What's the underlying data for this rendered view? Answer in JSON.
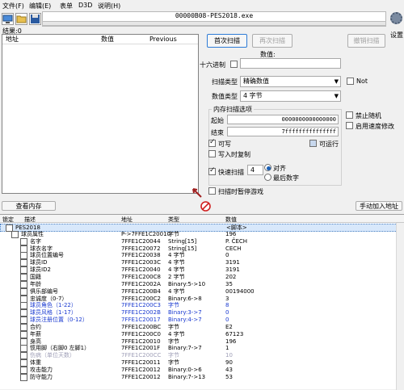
{
  "menu": {
    "file": "文件(F)",
    "edit": "编辑(E)",
    "table": "表单",
    "d3d": "D3D",
    "help": "说明(H)"
  },
  "process_title": "00000B08-PES2018.exe",
  "settings_label": "设置",
  "result_label": "结果:0",
  "found_list": {
    "col_address": "地址",
    "col_value": "数值",
    "col_previous": "Previous"
  },
  "scan": {
    "first_scan": "首次扫描",
    "next_scan": "再次扫描",
    "undo_scan": "撤销扫描",
    "value_label": "数值:",
    "hex_label": "十六进制",
    "scan_type_label": "扫描类型",
    "scan_type_value": "精确数值",
    "not_label": "Not",
    "value_type_label": "数值类型",
    "value_type_value": "4 字节",
    "memory_options_label": "内存扫描选项",
    "start_label": "起始",
    "start_value": "0000000000000000",
    "stop_label": "结束",
    "stop_value": "7fffffffffffffff",
    "writable": "可写",
    "executable": "可运行",
    "copy_on_write": "写入时复制",
    "fast_scan": "快速扫描",
    "fast_scan_value": "4",
    "alignment": "对齐",
    "last_digits": "最后数字",
    "pause_game": "扫描时暂停游戏",
    "disable_random": "禁止随机",
    "speedhack": "启用速度修改"
  },
  "buttons": {
    "memory_view": "查看内存",
    "add_manually": "手动加入地址"
  },
  "table": {
    "headers": {
      "active": "锁定",
      "description": "描述",
      "address": "地址",
      "type": "类型",
      "value": "数值"
    },
    "rows": [
      {
        "desc": "PES2018",
        "addr": "",
        "type": "",
        "value": "<脚本>",
        "cb": true,
        "indent": 0,
        "style": "sel"
      },
      {
        "desc": "球员属性",
        "addr": "P->7FFE1C20010",
        "type": "字节",
        "value": "196",
        "cb": true,
        "indent": 1,
        "style": ""
      },
      {
        "desc": "名字",
        "addr": "7FFE1C20044",
        "type": "String[15]",
        "value": "P. ČECH",
        "cb": true,
        "indent": 2,
        "style": ""
      },
      {
        "desc": "球衣名字",
        "addr": "7FFE1C20072",
        "type": "String[15]",
        "value": "CECH",
        "cb": true,
        "indent": 2,
        "style": ""
      },
      {
        "desc": "球员位置编号",
        "addr": "7FFE1C20038",
        "type": "4 字节",
        "value": "0",
        "cb": true,
        "indent": 2,
        "style": ""
      },
      {
        "desc": "球员ID",
        "addr": "7FFE1C2003C",
        "type": "4 字节",
        "value": "3191",
        "cb": true,
        "indent": 2,
        "style": ""
      },
      {
        "desc": "球员ID2",
        "addr": "7FFE1C20040",
        "type": "4 字节",
        "value": "3191",
        "cb": true,
        "indent": 2,
        "style": ""
      },
      {
        "desc": "国籍",
        "addr": "7FFE1C200C8",
        "type": "2 字节",
        "value": "202",
        "cb": true,
        "indent": 2,
        "style": ""
      },
      {
        "desc": "年龄",
        "addr": "7FFE1C2002A",
        "type": "Binary:5->10",
        "value": "35",
        "cb": true,
        "indent": 2,
        "style": ""
      },
      {
        "desc": "俱乐部编号",
        "addr": "7FFE1C200B4",
        "type": "4 字节",
        "value": "00194000",
        "cb": true,
        "indent": 2,
        "style": ""
      },
      {
        "desc": "忠诚度（0-7）",
        "addr": "7FFE1C200C2",
        "type": "Binary:6->8",
        "value": "3",
        "cb": true,
        "indent": 2,
        "style": ""
      },
      {
        "desc": "球员角色（1-22）",
        "addr": "7FFE1C200C3",
        "type": "字节",
        "value": "8",
        "cb": true,
        "indent": 2,
        "style": "blue"
      },
      {
        "desc": "球员风格（1-17）",
        "addr": "7FFE1C2002B",
        "type": "Binary:3->7",
        "value": "0",
        "cb": true,
        "indent": 2,
        "style": "blue"
      },
      {
        "desc": "球员注册位置（0-12）",
        "addr": "7FFE1C20017",
        "type": "Binary:4->7",
        "value": "0",
        "cb": true,
        "indent": 2,
        "style": "blue"
      },
      {
        "desc": "合约",
        "addr": "7FFE1C200BC",
        "type": "字节",
        "value": "E2",
        "cb": true,
        "indent": 2,
        "style": ""
      },
      {
        "desc": "年薪",
        "addr": "7FFE1C200C0",
        "type": "4 字节",
        "value": "67123",
        "cb": true,
        "indent": 2,
        "style": ""
      },
      {
        "desc": "身高",
        "addr": "7FFE1C20010",
        "type": "字节",
        "value": "196",
        "cb": true,
        "indent": 2,
        "style": ""
      },
      {
        "desc": "惯用脚（右脚0 左脚1）",
        "addr": "7FFE1C2001F",
        "type": "Binary:7->7",
        "value": "1",
        "cb": true,
        "indent": 2,
        "style": ""
      },
      {
        "desc": "伤病（单位天数）",
        "addr": "7FFE1C200CC",
        "type": "字节",
        "value": "10",
        "cb": true,
        "indent": 2,
        "style": "gray"
      },
      {
        "desc": "体重",
        "addr": "7FFE1C20011",
        "type": "字节",
        "value": "90",
        "cb": true,
        "indent": 2,
        "style": ""
      },
      {
        "desc": "攻击能力",
        "addr": "7FFE1C20012",
        "type": "Binary:0->6",
        "value": "43",
        "cb": true,
        "indent": 2,
        "style": ""
      },
      {
        "desc": "防守能力",
        "addr": "7FFE1C20012",
        "type": "Binary:7->13",
        "value": "53",
        "cb": true,
        "indent": 2,
        "style": ""
      }
    ]
  }
}
